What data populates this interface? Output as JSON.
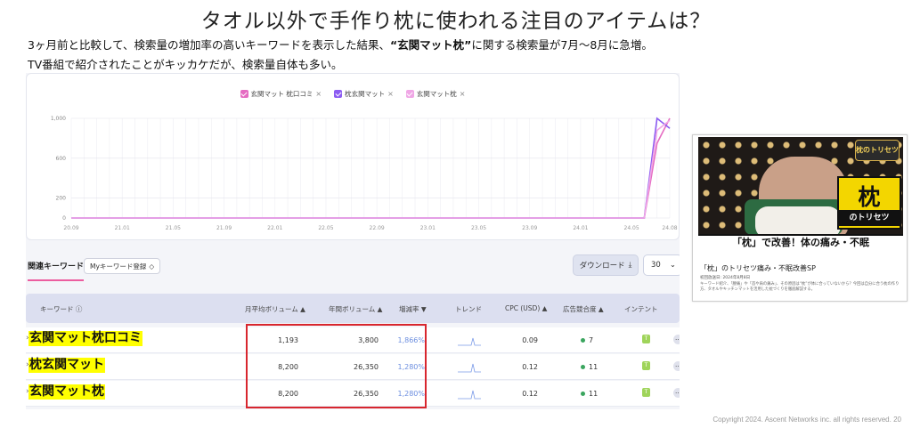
{
  "slide": {
    "title": "タオル以外で手作り枕に使われる注目のアイテムは？",
    "desc1_pre": "3ヶ月前と比較して、検索量の増加率の高いキーワードを表示した結果、",
    "desc1_bold": "“玄関マット枕”",
    "desc1_post": "に関する検索量が7月〜8月に急増。",
    "desc2": "TV番組で紹介されたことがキッカケだが、検索量自体も多い。",
    "copyright": "Copyright 2024. Ascent Networks inc. all rights reserved.",
    "page_number": "20"
  },
  "legend": [
    {
      "label": "玄関マット 枕口コミ",
      "color": "#e56cc2"
    },
    {
      "label": "枕玄関マット",
      "color": "#8c5cf2"
    },
    {
      "label": "玄関マット枕",
      "color": "#f0a7e6"
    }
  ],
  "chart_data": {
    "type": "line",
    "title": "",
    "xlabel": "",
    "ylabel": "",
    "x_ticks": [
      "20.09",
      "21.01",
      "21.05",
      "21.09",
      "22.01",
      "22.05",
      "22.09",
      "23.01",
      "23.05",
      "23.09",
      "24.01",
      "24.05",
      "24.08"
    ],
    "y_ticks": [
      "0",
      "200",
      "600",
      "1,000"
    ],
    "ylim": [
      0,
      1000
    ],
    "series": [
      {
        "name": "玄関マット 枕口コミ",
        "color": "#e56cc2",
        "x": [
          "20.09",
          "24.05",
          "24.06",
          "24.07",
          "24.08"
        ],
        "values": [
          0,
          0,
          0,
          750,
          1000
        ]
      },
      {
        "name": "枕玄関マット",
        "color": "#8c5cf2",
        "x": [
          "20.09",
          "24.05",
          "24.06",
          "24.07",
          "24.08"
        ],
        "values": [
          0,
          0,
          0,
          1000,
          900
        ]
      },
      {
        "name": "玄関マット枕",
        "color": "#f0a7e6",
        "x": [
          "20.09",
          "24.05",
          "24.06",
          "24.07",
          "24.08"
        ],
        "values": [
          0,
          0,
          0,
          880,
          980
        ]
      }
    ],
    "grid": true
  },
  "section": {
    "tab_label": "関連キーワード",
    "my_keyword_label": "Myキーワード登録",
    "download_label": "ダウンロード",
    "per_page": "30"
  },
  "table": {
    "headers": {
      "keyword": "キーワード",
      "monthly": "月平均ボリューム",
      "yearly": "年間ボリューム",
      "growth": "増減率",
      "trend": "トレンド",
      "cpc": "CPC (USD)",
      "competition": "広告競合度",
      "intent": "インテント"
    },
    "rows": [
      {
        "keyword": "玄関マット枕口コミ",
        "monthly": "1,193",
        "yearly": "3,800",
        "growth": "1,866%",
        "cpc": "0.09",
        "competition": "7",
        "intent": "T"
      },
      {
        "keyword": "枕玄関マット",
        "monthly": "8,200",
        "yearly": "26,350",
        "growth": "1,280%",
        "cpc": "0.12",
        "competition": "11",
        "intent": "T"
      },
      {
        "keyword": "玄関マット枕",
        "monthly": "8,200",
        "yearly": "26,350",
        "growth": "1,280%",
        "cpc": "0.12",
        "competition": "11",
        "intent": "T"
      }
    ]
  },
  "article": {
    "badge": "枕のトリセツ",
    "kanji": "枕",
    "kanji_sub": "のトリセツ",
    "banner": "「枕」で改善！体の痛み・不眠",
    "title": "「枕」のトリセツ痛み・不眠改善SP",
    "date": "初回放送日: 2024年8月8日",
    "text": "キーワード紹介、「腰痛」や「首や肩の痛み」、その原因は“枕”が体に合っていないから？今回は自分に合う枕の作り方、タオルやキッチンマットを活用した枕づくりを徹底解説する。"
  }
}
